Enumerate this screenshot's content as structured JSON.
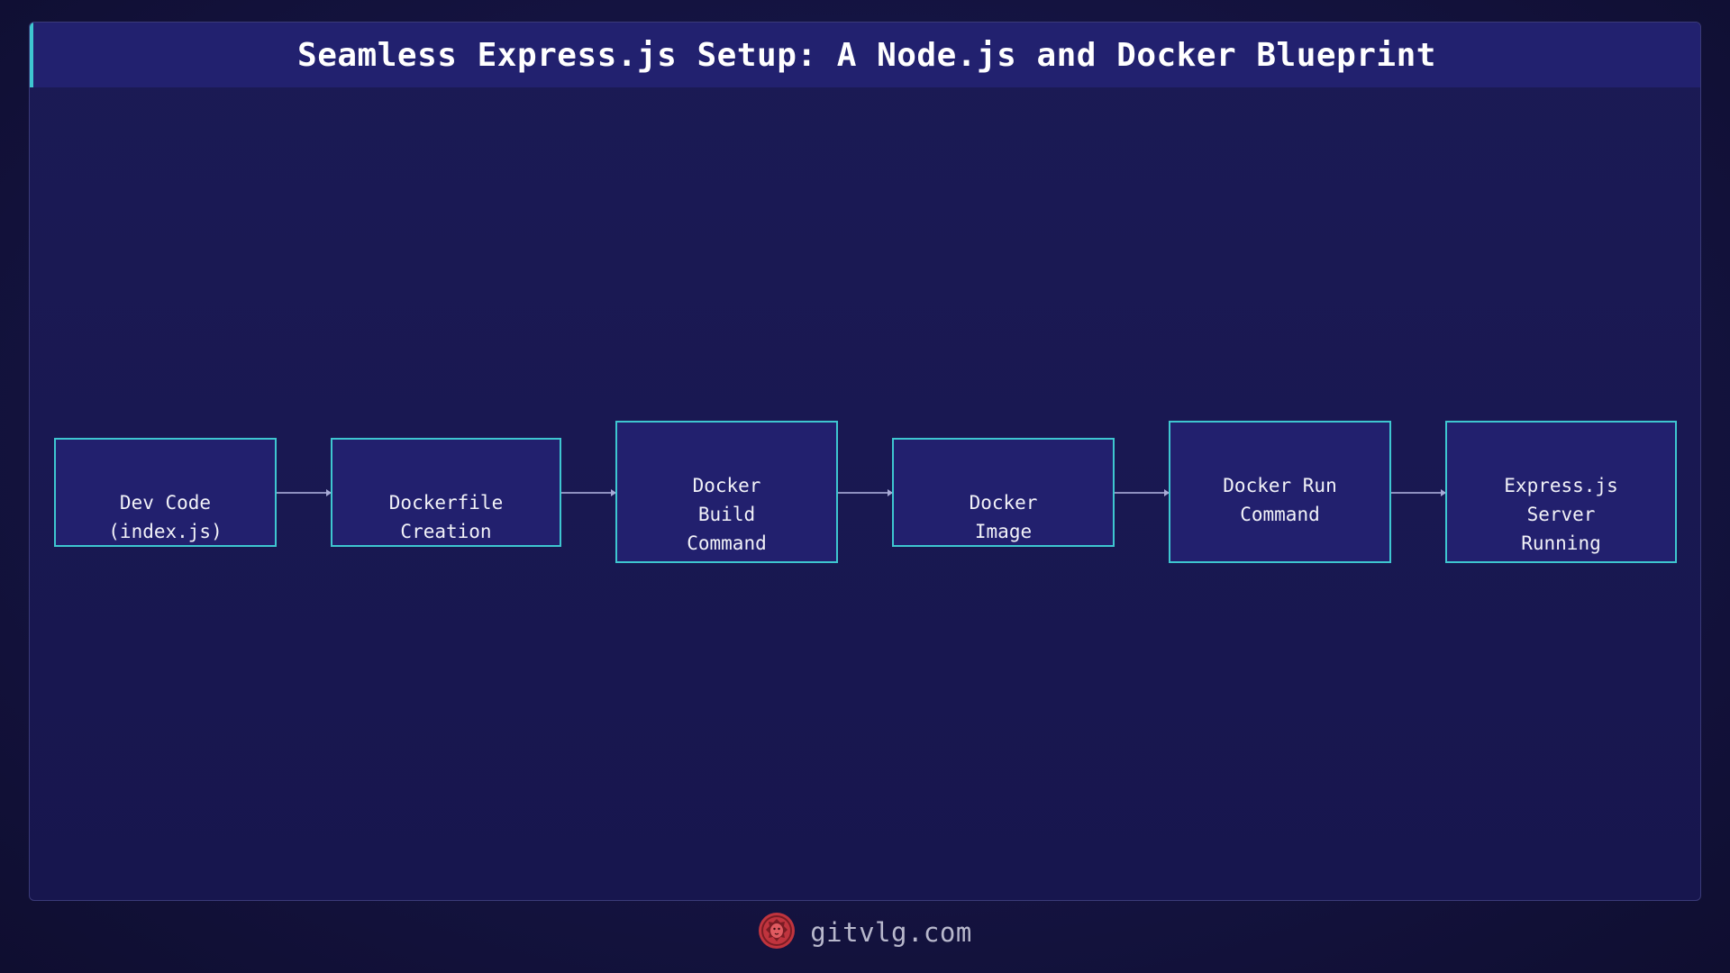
{
  "title": "Seamless Express.js Setup: A Node.js and Docker Blueprint",
  "colors": {
    "accent": "#3ec6d0",
    "node_fill": "#22206e",
    "title_bar": "#22216f",
    "background": "#17164e",
    "logo": "#c0343e"
  },
  "nodes": [
    {
      "id": "dev-code",
      "label": "Dev Code\n(index.js)"
    },
    {
      "id": "dockerfile-creation",
      "label": "Dockerfile\nCreation"
    },
    {
      "id": "docker-build-command",
      "label": "Docker\nBuild\nCommand"
    },
    {
      "id": "docker-image",
      "label": "Docker\nImage"
    },
    {
      "id": "docker-run-command",
      "label": "Docker Run\nCommand"
    },
    {
      "id": "express-server-running",
      "label": "Express.js\nServer\nRunning"
    }
  ],
  "edges": [
    {
      "from": "dev-code",
      "to": "dockerfile-creation"
    },
    {
      "from": "dockerfile-creation",
      "to": "docker-build-command"
    },
    {
      "from": "docker-build-command",
      "to": "docker-image"
    },
    {
      "from": "docker-image",
      "to": "docker-run-command"
    },
    {
      "from": "docker-run-command",
      "to": "express-server-running"
    }
  ],
  "footer": {
    "logo_icon": "lion-head-icon",
    "text": "gitvlg.com"
  }
}
